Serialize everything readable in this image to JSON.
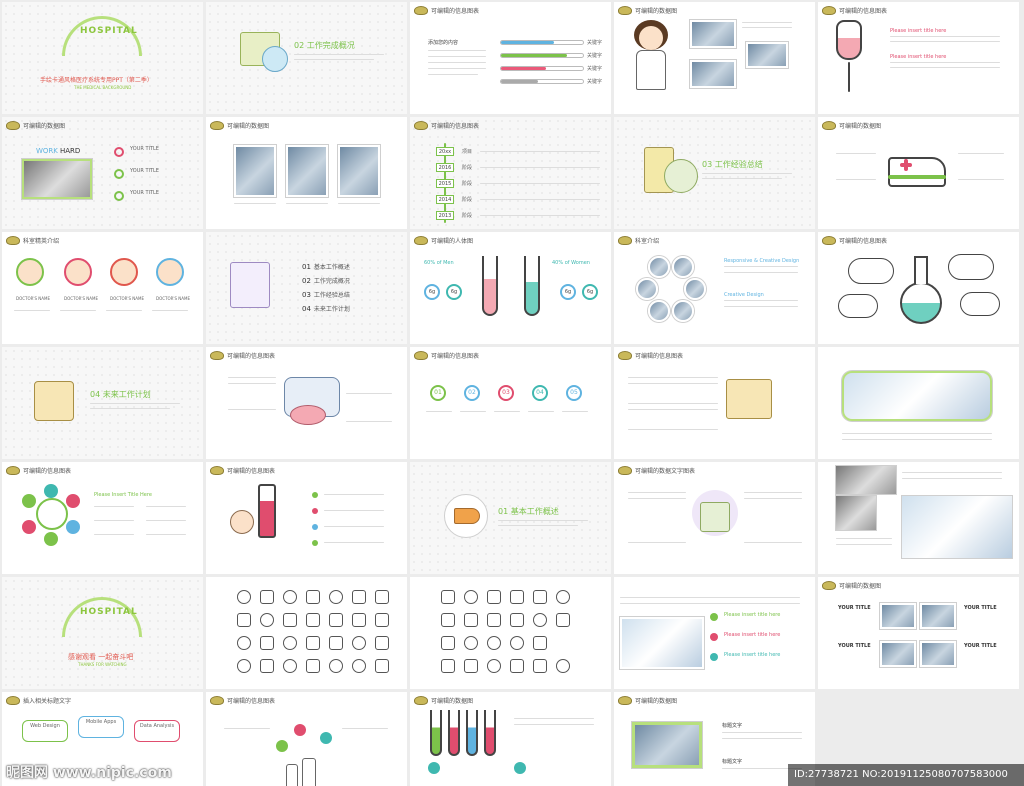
{
  "cover": {
    "title": "手绘卡通风格医疗系统专用PPT（第二季）",
    "subtitle": "THE MEDICAL BACKGROUND",
    "deco_word": "HOSPITAL"
  },
  "section_labels": {
    "s2": "02 工作完成概况",
    "s3": "03 工作经验总结",
    "s4": "04 未来工作计划",
    "s1": "01 基本工作概述"
  },
  "headers": {
    "edit_chart": "可编辑的信息图表",
    "edit_data": "可编辑的数据图",
    "edit_human": "可编辑的人体图",
    "dept_intro": "科室精英介绍",
    "dept_intro2": "科室介绍",
    "edit_text_chart": "可编辑的数据文字图表",
    "insert_text": "插入相关标题文字"
  },
  "slide3": {
    "heading": "添加您的内容",
    "labels": [
      "关键字",
      "关键字",
      "关键字",
      "关键字"
    ],
    "progress": [
      0.65,
      0.8,
      0.55,
      0.45
    ],
    "colors": [
      "#5fb3e0",
      "#7cc24a",
      "#ea5a7a",
      "#aaaaaa"
    ]
  },
  "slide5": {
    "items": [
      "Please insert title here",
      "Please insert title here"
    ]
  },
  "slide6": {
    "work": "WORK",
    "hard": "HARD",
    "items": [
      "YOUR TITLE",
      "YOUR TITLE",
      "YOUR TITLE"
    ]
  },
  "slide8": {
    "years": [
      "20xx",
      "2016",
      "2015",
      "2014",
      "2013"
    ],
    "labels": [
      "项目",
      "阶段",
      "阶段",
      "阶段",
      "阶段"
    ]
  },
  "slide11": {
    "captions": [
      "DOCTOR'S NAME",
      "DOCTOR'S NAME",
      "DOCTOR'S NAME",
      "DOCTOR'S NAME"
    ],
    "colors": [
      "#7cc24a",
      "#e04d6e",
      "#e0574d",
      "#5fb3e0"
    ]
  },
  "slide12": {
    "toc": [
      {
        "n": "01",
        "t": "基本工作概述"
      },
      {
        "n": "02",
        "t": "工作完成概况"
      },
      {
        "n": "03",
        "t": "工作经验总结"
      },
      {
        "n": "04",
        "t": "未来工作计划"
      }
    ]
  },
  "slide13": {
    "left_title": "60% of Men",
    "right_title": "40% of Women",
    "values": [
      "6g",
      "6g",
      "6g",
      "6g"
    ]
  },
  "slide14": {
    "items": [
      "Responsive & Creative Design",
      "Creative Design"
    ]
  },
  "slide18": {
    "numbers": [
      "01",
      "02",
      "03",
      "04",
      "05"
    ],
    "colors": [
      "#7cc24a",
      "#5fb3e0",
      "#e04d6e",
      "#3fb8b0",
      "#5fb3e0"
    ]
  },
  "slide21": {
    "heading": "Please Insert Title Here"
  },
  "slide26": {
    "thanks": "感谢观看 一起奋斗吧",
    "thanks_en": "THANKS FOR WATCHING"
  },
  "slide29": {
    "items": [
      "Please insert title here",
      "Please insert title here",
      "Please insert title here"
    ]
  },
  "slide30": {
    "titles": [
      "YOUR TITLE",
      "YOUR TITLE",
      "YOUR TITLE",
      "YOUR TITLE"
    ]
  },
  "slide31": {
    "pills": [
      "Web Design",
      "Mobile Apps",
      "Data Analysis"
    ]
  },
  "slide34": {
    "labels": [
      "标题文字",
      "标题文字"
    ]
  },
  "watermark": {
    "site": "昵图网 www.nipic.com",
    "id": "ID:27738721 NO:20191125080707583000"
  }
}
